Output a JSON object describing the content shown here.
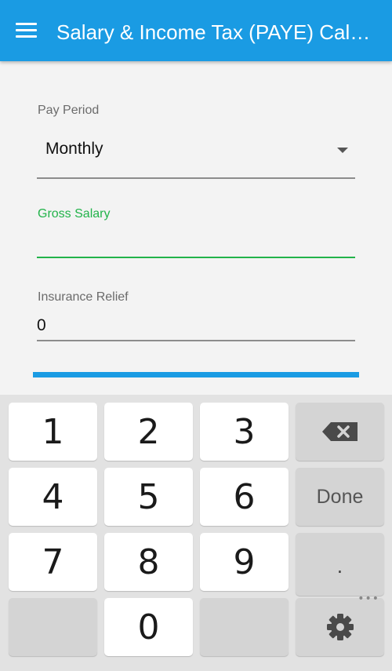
{
  "app": {
    "title": "Salary & Income Tax (PAYE) Cal…",
    "menu_icon": "hamburger-menu-icon",
    "accent_color": "#1a9be3",
    "focus_color": "#22b34a"
  },
  "form": {
    "pay_period": {
      "label": "Pay Period",
      "value": "Monthly"
    },
    "gross_salary": {
      "label": "Gross Salary",
      "value": ""
    },
    "insurance_relief": {
      "label": "Insurance Relief",
      "value": "0"
    }
  },
  "keyboard": {
    "keys": [
      "1",
      "2",
      "3",
      "4",
      "5",
      "6",
      "7",
      "8",
      "9",
      "0"
    ],
    "done_label": "Done",
    "dot_label": ".",
    "more_label": "•••",
    "backspace_icon": "backspace-icon",
    "settings_icon": "gear-icon"
  }
}
